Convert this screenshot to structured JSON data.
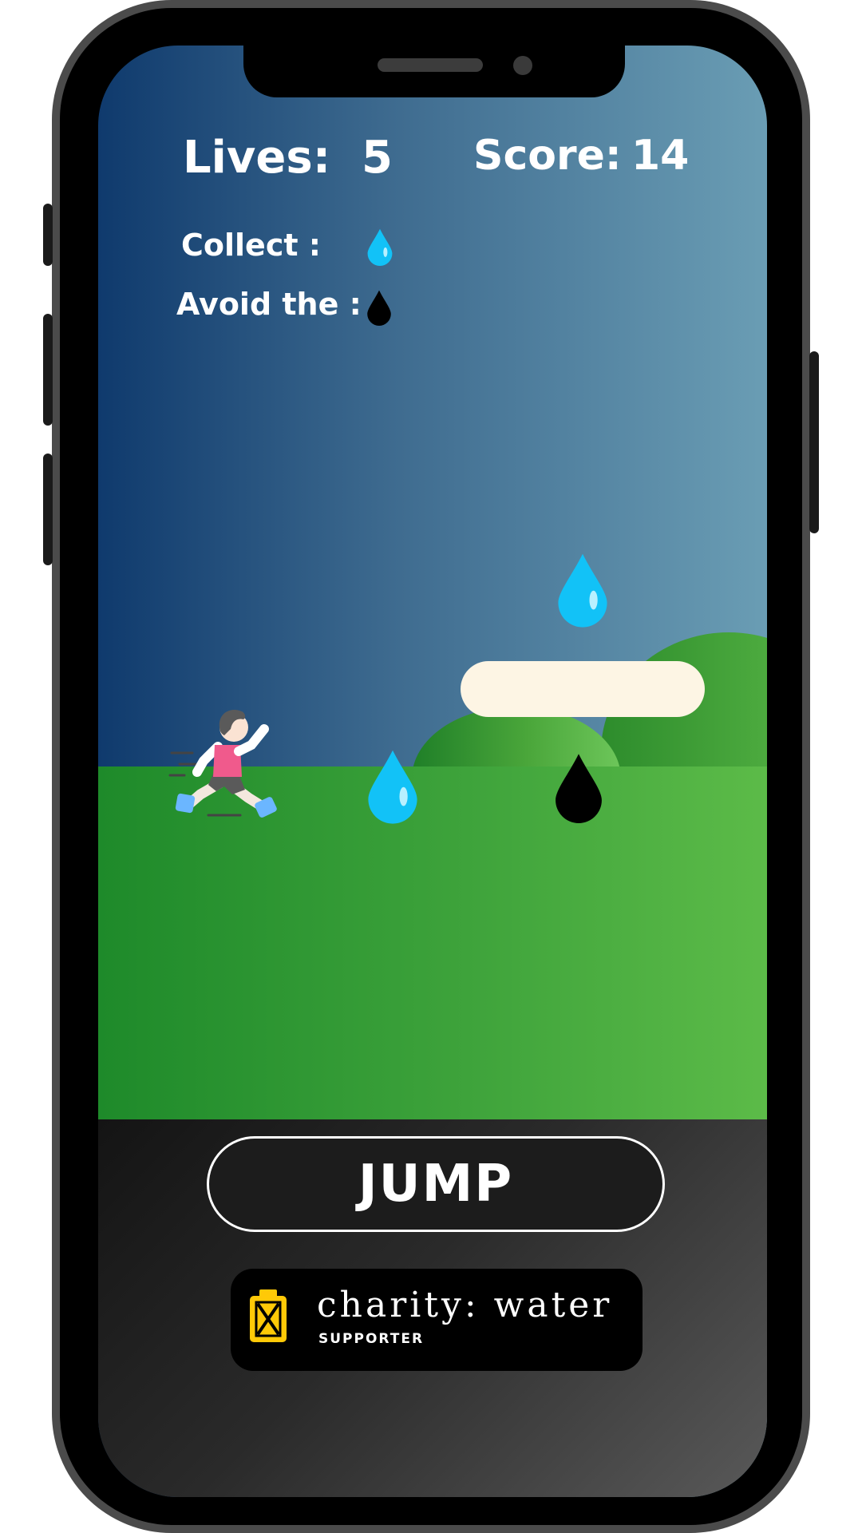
{
  "hud": {
    "lives_label": "Lives:",
    "lives_value": "5",
    "score_label": "Score:",
    "score_value": "14",
    "collect_label": "Collect :",
    "avoid_label": "Avoid the :"
  },
  "controls": {
    "jump_label": "JUMP"
  },
  "badge": {
    "title": "charity: water",
    "subtitle": "SUPPORTER"
  },
  "icons": {
    "collect": "water-drop-icon",
    "avoid": "oil-drop-icon",
    "badge": "jerry-can-icon",
    "player": "runner-character"
  },
  "colors": {
    "water_drop": "#12c2f7",
    "oil_drop": "#000000",
    "jerry_can": "#ffc907",
    "platform": "#fdf5e4",
    "sky_left": "#0f3a6d",
    "sky_right": "#6a9db4",
    "grass": "#3ea33b"
  }
}
